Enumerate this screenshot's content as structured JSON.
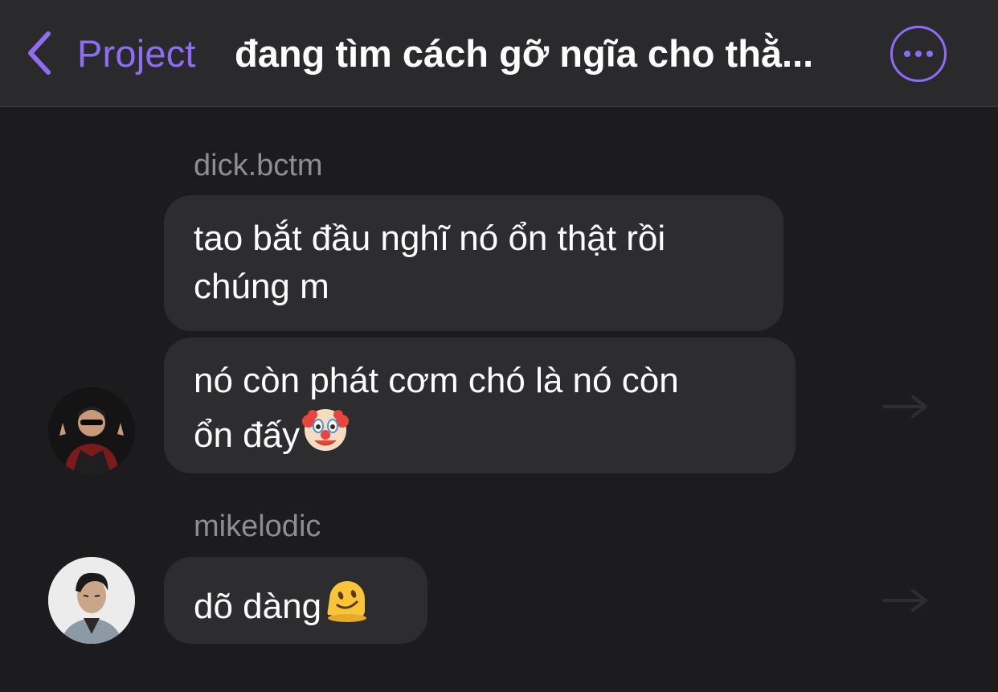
{
  "header": {
    "back_label": "Project",
    "title": "đang tìm cách gỡ ngĩa cho thằ..."
  },
  "messages": [
    {
      "sender": "dick.bctm",
      "bubbles": [
        {
          "lines": [
            "tao bắt đầu nghĩ nó ổn thật rồi",
            "chúng m"
          ]
        },
        {
          "lines": [
            "nó còn phát cơm chó là nó còn",
            "ổn đấy"
          ],
          "emoji": "clown-face-icon"
        }
      ]
    },
    {
      "sender": "mikelodic",
      "bubbles": [
        {
          "lines": [
            "dõ dàng"
          ],
          "emoji": "melting-face-icon"
        }
      ]
    }
  ],
  "colors": {
    "accent": "#8e6cf6",
    "background": "#1c1c1e",
    "header_bg": "#2a2a2d",
    "bubble_bg": "#2d2d30",
    "sender_name": "#8d8d93"
  }
}
